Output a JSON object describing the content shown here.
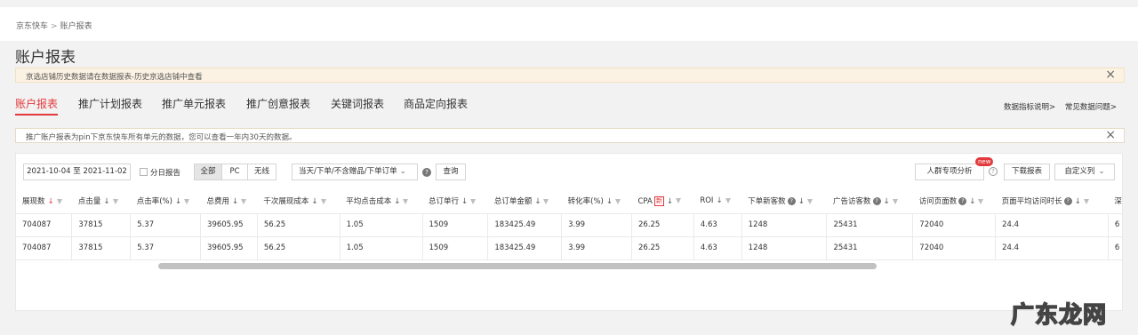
{
  "breadcrumb": {
    "root": "京东快车",
    "sep": ">",
    "current": "账户报表"
  },
  "page_title": "账户报表",
  "top_notice": {
    "text": "京选店铺历史数据请在数据报表-历史京选店铺中查看",
    "close": "×"
  },
  "tabs": [
    "账户报表",
    "推广计划报表",
    "推广单元报表",
    "推广创意报表",
    "关键词报表",
    "商品定向报表"
  ],
  "links": {
    "metrics": "数据指标说明>",
    "faq": "常见数据问题>"
  },
  "info_notice": {
    "text": "推广账户报表为pin下京东快车所有单元的数据，您可以查看一年内30天的数据。",
    "close": "×"
  },
  "toolbar": {
    "date_range": "2021-10-04 至 2021-11-02",
    "daily_report": "分日报告",
    "device": [
      "全部",
      "PC",
      "无线"
    ],
    "order_select": "当天/下单/不含赠品/下单订单",
    "query": "查询",
    "crowd": "人群专项分析",
    "new_badge": "new",
    "download": "下载报表",
    "custom": "自定义列"
  },
  "table": {
    "columns": [
      "展现数",
      "点击量",
      "点击率(%)",
      "总费用",
      "千次展现成本",
      "平均点击成本",
      "总订单行",
      "总订单金额",
      "转化率(%)",
      "CPA",
      "ROI",
      "下单新客数",
      "广告访客数",
      "访问页面数",
      "页面平均访问时长",
      "深"
    ],
    "cpa_badge": "新",
    "rows": [
      [
        "704087",
        "37815",
        "5.37",
        "39605.95",
        "56.25",
        "1.05",
        "1509",
        "183425.49",
        "3.99",
        "26.25",
        "4.63",
        "1248",
        "25431",
        "72040",
        "24.4",
        "6"
      ],
      [
        "704087",
        "37815",
        "5.37",
        "39605.95",
        "56.25",
        "1.05",
        "1509",
        "183425.49",
        "3.99",
        "26.25",
        "4.63",
        "1248",
        "25431",
        "72040",
        "24.4",
        "6"
      ]
    ]
  },
  "watermark": "广东龙网",
  "colors": {
    "accent": "#e4393c",
    "notice_bg": "#fbf2e3"
  }
}
